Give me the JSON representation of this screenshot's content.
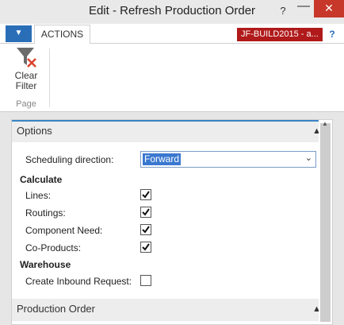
{
  "window": {
    "title": "Edit - Refresh Production Order",
    "help_glyph": "?",
    "minimize_glyph": "—",
    "close_glyph": "✕"
  },
  "ribbon": {
    "menu_glyph": "▼",
    "tab_label": "ACTIONS",
    "company": "JF-BUILD2015 - a...",
    "help_glyph": "?",
    "actions": [
      {
        "label_line1": "Clear",
        "label_line2": "Filter",
        "icon": "clear-filter-icon"
      }
    ],
    "group_label": "Page"
  },
  "options": {
    "header": "Options",
    "scheduling_direction_label": "Scheduling direction:",
    "scheduling_direction_value": "Forward",
    "calculate_title": "Calculate",
    "lines_label": "Lines:",
    "lines_checked": true,
    "routings_label": "Routings:",
    "routings_checked": true,
    "component_need_label": "Component Need:",
    "component_need_checked": true,
    "co_products_label": "Co-Products:",
    "co_products_checked": true,
    "warehouse_title": "Warehouse",
    "create_inbound_label": "Create Inbound Request:",
    "create_inbound_checked": false
  },
  "production_order": {
    "header": "Production Order"
  },
  "colors": {
    "accent": "#2a6eb8",
    "company_badge": "#b01a1a",
    "close_button": "#c7382a",
    "selection": "#3a78d0"
  }
}
